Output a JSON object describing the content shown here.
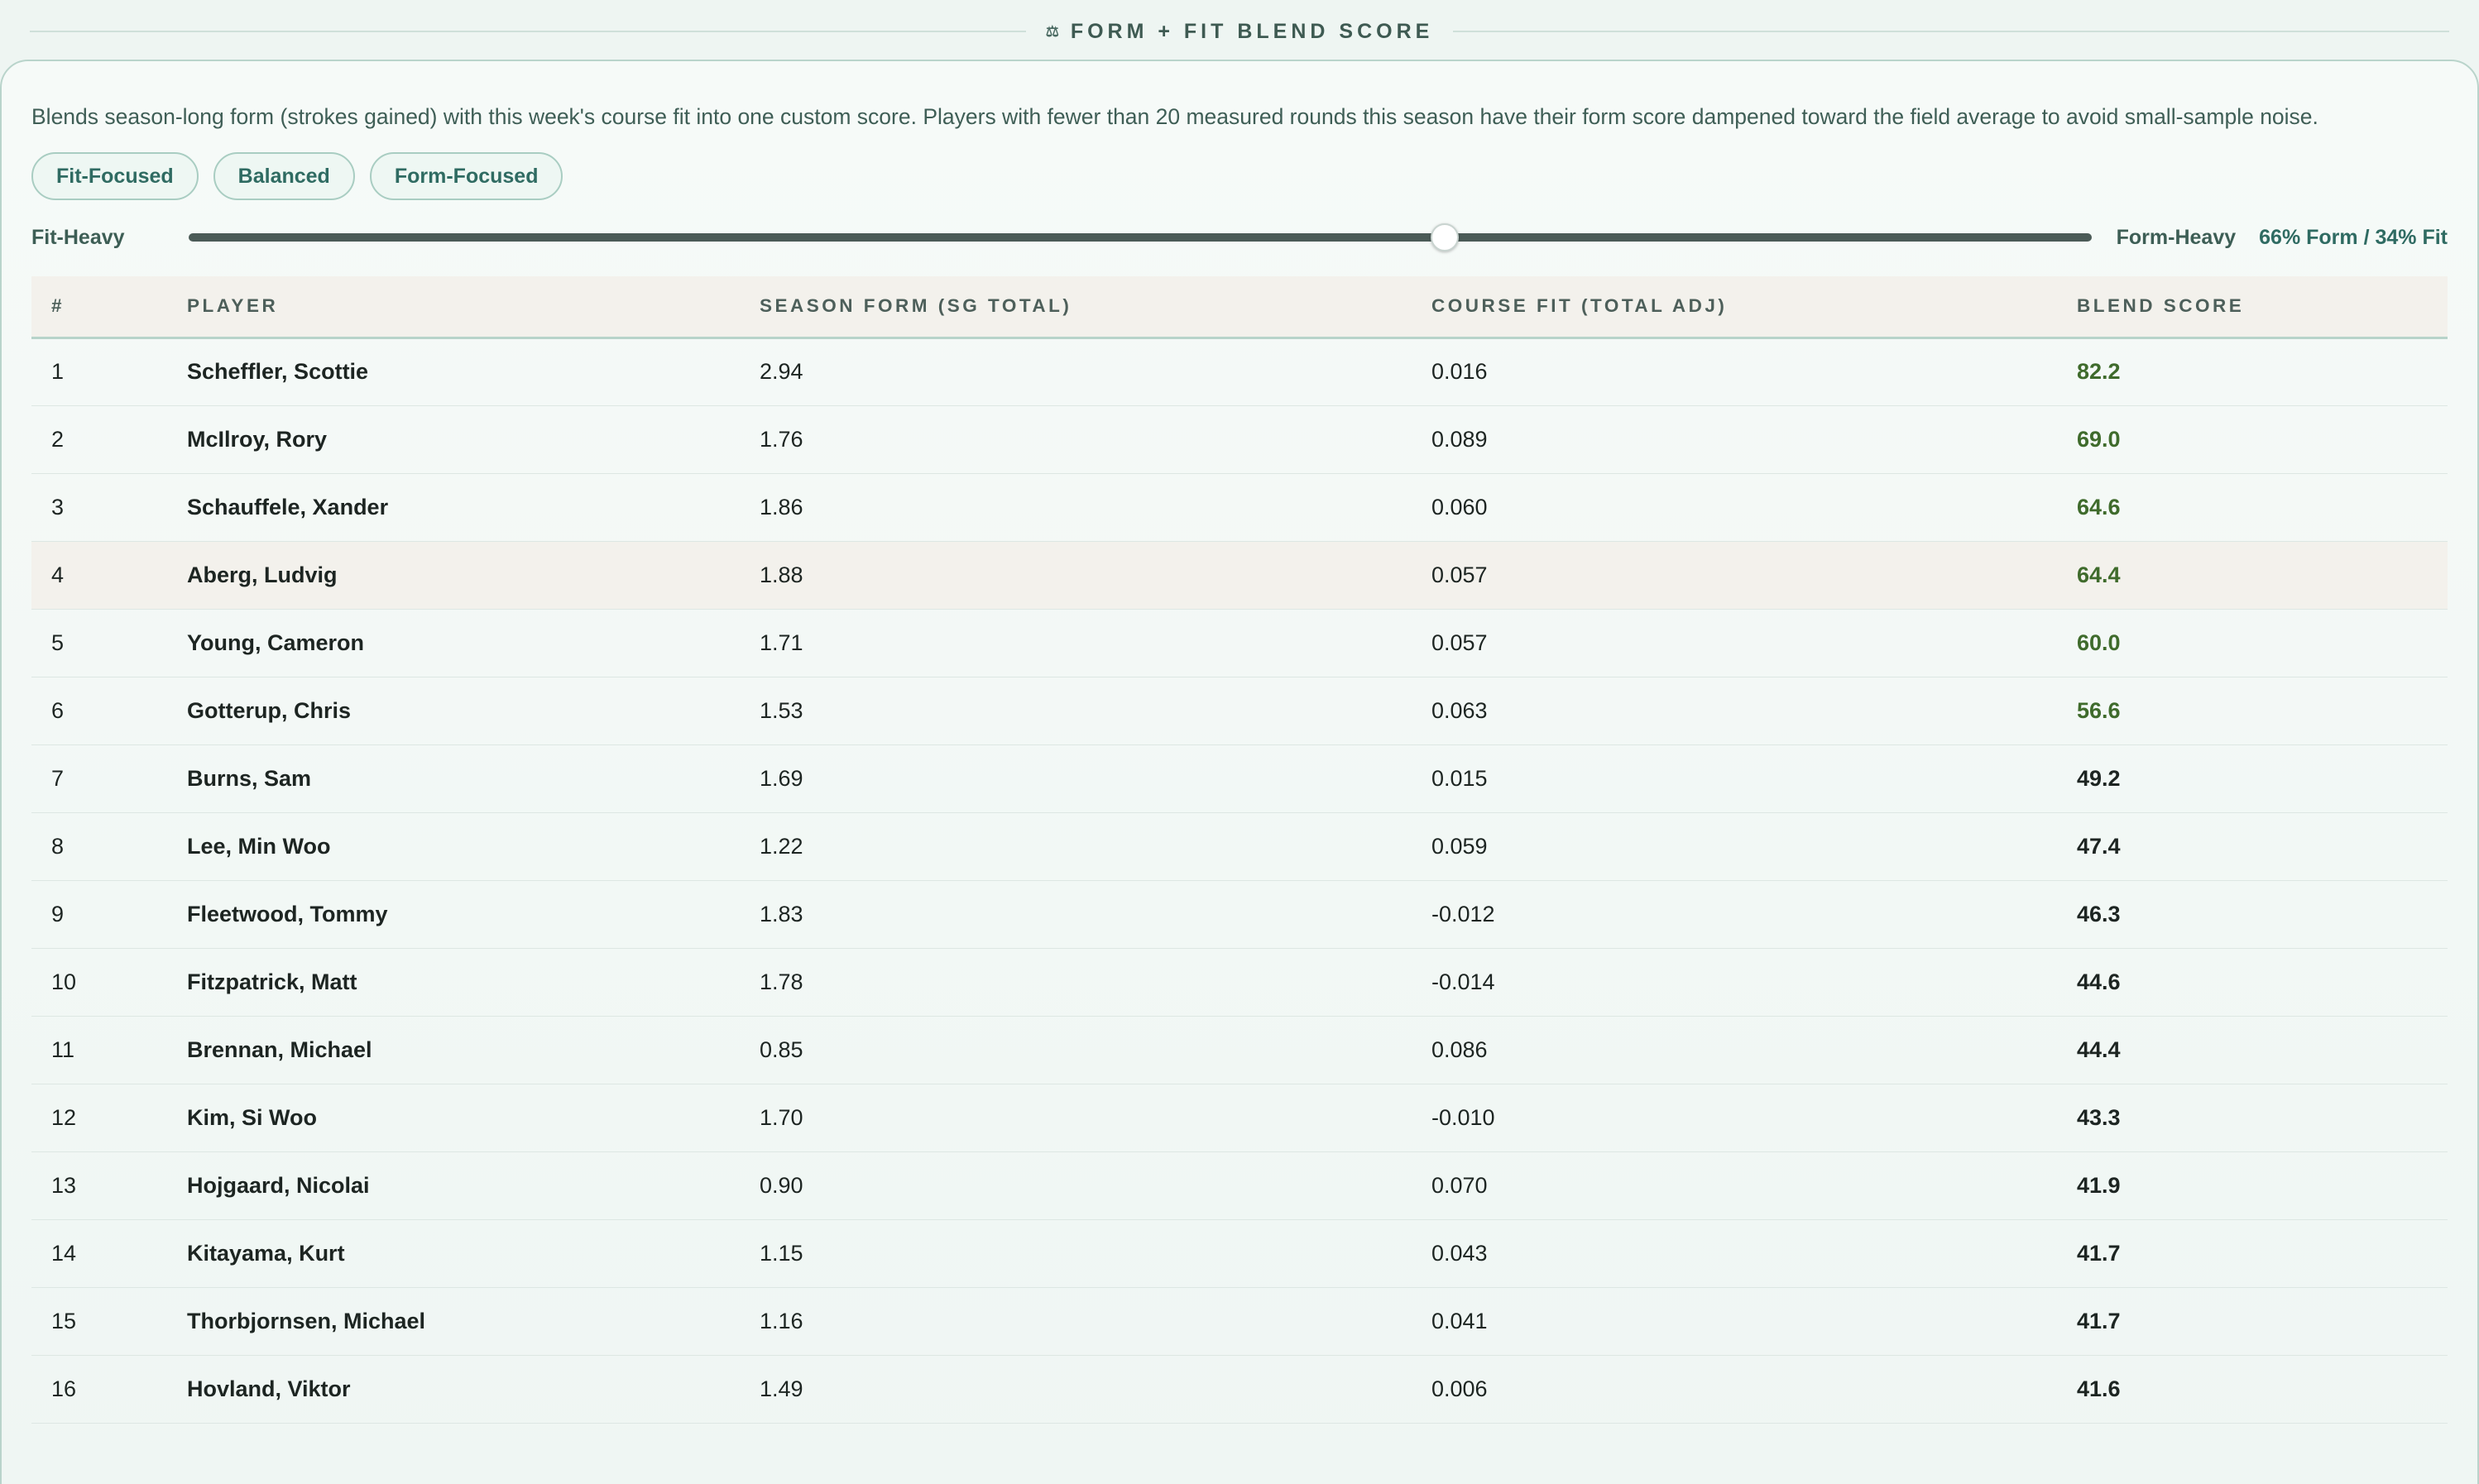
{
  "header": {
    "icon": "scale-icon",
    "title": "FORM + FIT BLEND SCORE"
  },
  "description": "Blends season-long form (strokes gained) with this week's course fit into one custom score. Players with fewer than 20 measured rounds this season have their form score dampened toward the field average to avoid small-sample noise.",
  "presets": [
    "Fit-Focused",
    "Balanced",
    "Form-Focused"
  ],
  "slider": {
    "left_label": "Fit-Heavy",
    "right_label": "Form-Heavy",
    "value": 0.66,
    "ratio_text": "66% Form / 34% Fit"
  },
  "table": {
    "columns": [
      "#",
      "PLAYER",
      "SEASON FORM (SG TOTAL)",
      "COURSE FIT (TOTAL ADJ)",
      "BLEND SCORE"
    ],
    "rows": [
      {
        "rank": "1",
        "player": "Scheffler, Scottie",
        "form": "2.94",
        "fit": "0.016",
        "blend": "82.2",
        "top": true
      },
      {
        "rank": "2",
        "player": "McIlroy, Rory",
        "form": "1.76",
        "fit": "0.089",
        "blend": "69.0",
        "top": true
      },
      {
        "rank": "3",
        "player": "Schauffele, Xander",
        "form": "1.86",
        "fit": "0.060",
        "blend": "64.6",
        "top": true
      },
      {
        "rank": "4",
        "player": "Aberg, Ludvig",
        "form": "1.88",
        "fit": "0.057",
        "blend": "64.4",
        "top": true,
        "highlight": true
      },
      {
        "rank": "5",
        "player": "Young, Cameron",
        "form": "1.71",
        "fit": "0.057",
        "blend": "60.0",
        "top": true
      },
      {
        "rank": "6",
        "player": "Gotterup, Chris",
        "form": "1.53",
        "fit": "0.063",
        "blend": "56.6",
        "top": true
      },
      {
        "rank": "7",
        "player": "Burns, Sam",
        "form": "1.69",
        "fit": "0.015",
        "blend": "49.2"
      },
      {
        "rank": "8",
        "player": "Lee, Min Woo",
        "form": "1.22",
        "fit": "0.059",
        "blend": "47.4"
      },
      {
        "rank": "9",
        "player": "Fleetwood, Tommy",
        "form": "1.83",
        "fit": "-0.012",
        "blend": "46.3"
      },
      {
        "rank": "10",
        "player": "Fitzpatrick, Matt",
        "form": "1.78",
        "fit": "-0.014",
        "blend": "44.6"
      },
      {
        "rank": "11",
        "player": "Brennan, Michael",
        "form": "0.85",
        "fit": "0.086",
        "blend": "44.4"
      },
      {
        "rank": "12",
        "player": "Kim, Si Woo",
        "form": "1.70",
        "fit": "-0.010",
        "blend": "43.3"
      },
      {
        "rank": "13",
        "player": "Hojgaard, Nicolai",
        "form": "0.90",
        "fit": "0.070",
        "blend": "41.9"
      },
      {
        "rank": "14",
        "player": "Kitayama, Kurt",
        "form": "1.15",
        "fit": "0.043",
        "blend": "41.7"
      },
      {
        "rank": "15",
        "player": "Thorbjornsen, Michael",
        "form": "1.16",
        "fit": "0.041",
        "blend": "41.7"
      },
      {
        "rank": "16",
        "player": "Hovland, Viktor",
        "form": "1.49",
        "fit": "0.006",
        "blend": "41.6"
      }
    ]
  },
  "colors": {
    "accent": "#2f6b62",
    "top_score": "#3f6b2c",
    "highlight_row": "#f3f1ec"
  }
}
